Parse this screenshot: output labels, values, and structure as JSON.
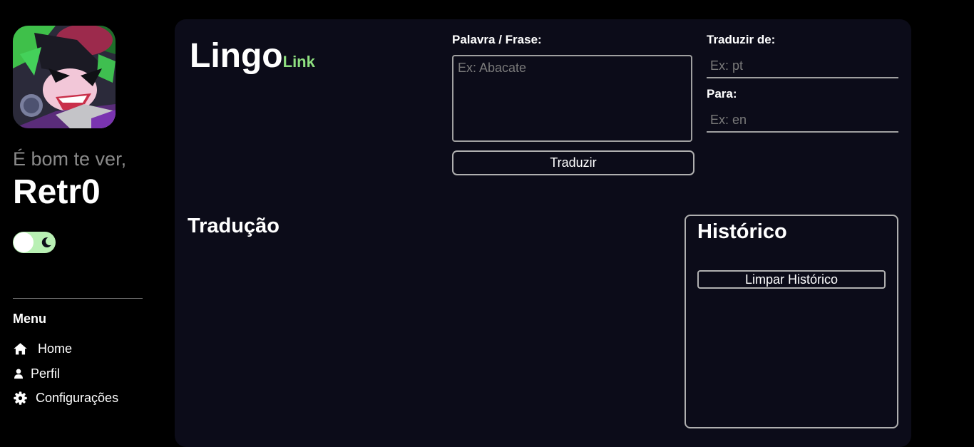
{
  "sidebar": {
    "greeting": "É bom te ver,",
    "username": "Retr0",
    "theme_toggle": {
      "state": "dark",
      "icon": "moon-icon"
    },
    "menu_title": "Menu",
    "menu_items": [
      {
        "label": "Home",
        "icon": "home-icon"
      },
      {
        "label": "Perfil",
        "icon": "user-icon"
      },
      {
        "label": "Configurações",
        "icon": "gear-icon"
      }
    ]
  },
  "header": {
    "logo_main": "Lingo",
    "logo_accent": "Link"
  },
  "form": {
    "word_label": "Palavra / Frase:",
    "word_placeholder": "Ex: Abacate",
    "translate_button": "Traduzir",
    "from_label": "Traduzir de:",
    "from_placeholder": "Ex: pt",
    "to_label": "Para:",
    "to_placeholder": "Ex: en"
  },
  "translation": {
    "title": "Tradução"
  },
  "history": {
    "title": "Histórico",
    "clear_button": "Limpar Histórico"
  },
  "colors": {
    "page_background": "#000000",
    "panel_background": "#0c0c19",
    "accent_green": "#8fe080",
    "toggle_track": "#b9f0b4"
  }
}
